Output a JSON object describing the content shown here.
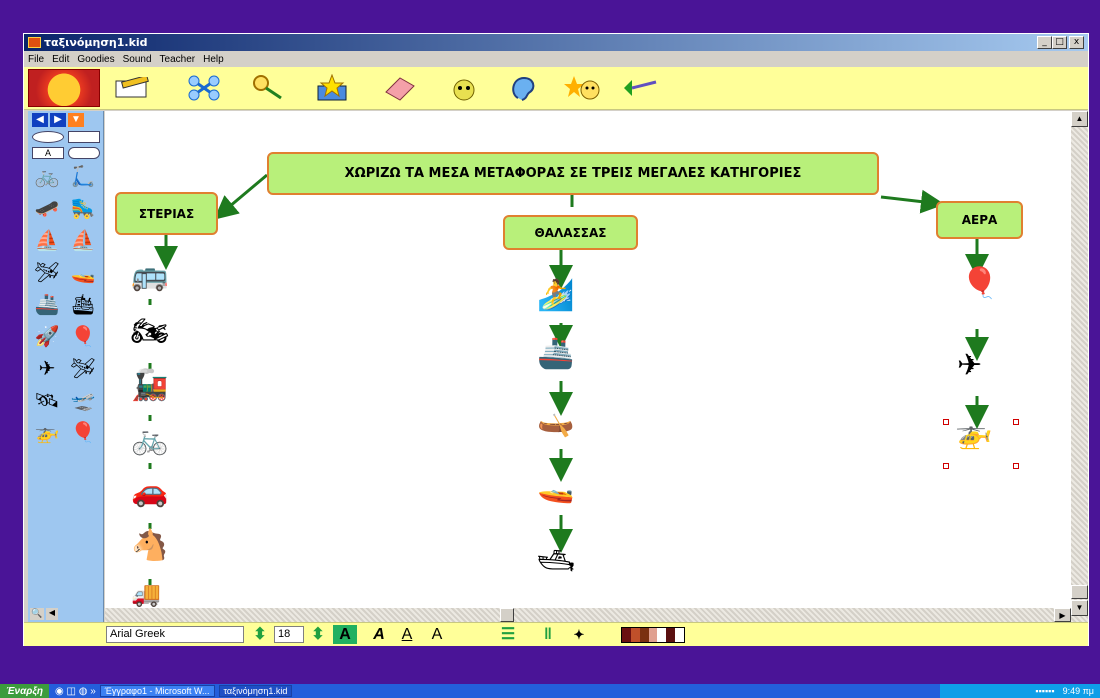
{
  "window": {
    "title": "ταξινόμηση1.kid",
    "min": "_",
    "max": "□",
    "close": "x"
  },
  "menu": [
    "File",
    "Edit",
    "Goodies",
    "Sound",
    "Teacher",
    "Help"
  ],
  "toolbar_icons": [
    "pencil-paper-icon",
    "network-icon",
    "magnifier-icon",
    "star-box-icon",
    "eraser-icon",
    "bulb-face-icon",
    "ear-icon",
    "faces-icon",
    "paintbrush-icon"
  ],
  "format": {
    "font": "Arial Greek",
    "size": "18",
    "bold": "A",
    "italic": "A",
    "underline": "A",
    "caps": "A"
  },
  "map": {
    "central": "ΧΩΡΙΖΩ ΤΑ ΜΕΣΑ ΜΕΤΑΦΟΡΑΣ ΣΕ ΤΡΕΙΣ ΜΕΓΑΛΕΣ ΚΑΤΗΓΟΡΙΕΣ",
    "land": "ΣΤΕΡΙΑΣ",
    "sea": "ΘΑΛΑΣΣΑΣ",
    "air": "ΑΕΡΑ"
  },
  "taskbar": {
    "start": "Έναρξη",
    "item1": "Έγγραφο1 - Microsoft W...",
    "item2": "ταξινόμηση1.kid",
    "clock": "9:49 πμ"
  },
  "colors": {
    "desktop": "#4a1497",
    "toolbar": "#ffff99",
    "node": "#b8f07a",
    "node_border": "#e08030",
    "arrow": "#1e7a1e"
  }
}
